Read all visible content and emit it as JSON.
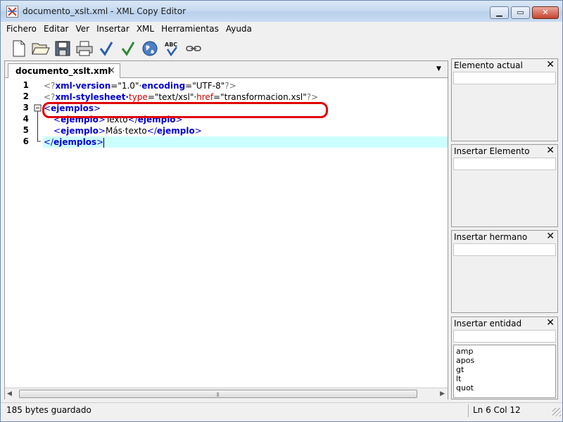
{
  "window": {
    "title": "documento_xslt.xml - XML Copy Editor"
  },
  "menu": [
    "Fichero",
    "Editar",
    "Ver",
    "Insertar",
    "XML",
    "Herramientas",
    "Ayuda"
  ],
  "toolbar": {
    "icons": [
      "new-document-icon",
      "open-folder-icon",
      "save-icon",
      "print-icon",
      "check-wellformed-icon",
      "validate-icon",
      "globe-icon",
      "spellcheck-icon",
      "link-icon"
    ]
  },
  "tab": {
    "label": "documento_xslt.xml",
    "close": "×"
  },
  "editor": {
    "line_numbers": [
      "1",
      "2",
      "3",
      "4",
      "5",
      "6"
    ],
    "lines": [
      {
        "p1": "<?",
        "p2": "xml·version",
        "p3": "=\"",
        "p4": "1.0",
        "p5": "\"·",
        "p6": "encoding",
        "p7": "=\"",
        "p8": "UTF-8",
        "p9": "\"",
        "p10": "?>"
      },
      {
        "p1": "<?",
        "p2": "xml-stylesheet·",
        "p3": "type",
        "p4": "=\"",
        "p5": "text/xsl",
        "p6": "\"·",
        "p7": "href",
        "p8": "=\"",
        "p9": "transformacion.xsl",
        "p10": "\"",
        "p11": "?>"
      },
      {
        "p1": "<",
        "p2": "ejemplos",
        "p3": ">"
      },
      {
        "p1": "<",
        "p2": "ejemplo",
        "p3": ">",
        "p4": "Texto",
        "p5": "</",
        "p6": "ejemplo",
        "p7": ">"
      },
      {
        "p1": "<",
        "p2": "ejemplo",
        "p3": ">",
        "p4": "Más·texto",
        "p5": "</",
        "p6": "ejemplo",
        "p7": ">"
      },
      {
        "p1": "</",
        "p2": "ejemplos",
        "p3": ">"
      }
    ],
    "current_line": 6
  },
  "panels": {
    "elemento_actual": {
      "title": "Elemento actual"
    },
    "insertar_elemento": {
      "title": "Insertar Elemento"
    },
    "insertar_hermano": {
      "title": "Insertar hermano"
    },
    "insertar_entidad": {
      "title": "Insertar entidad",
      "items": [
        "amp",
        "apos",
        "gt",
        "lt",
        "quot"
      ]
    }
  },
  "status": {
    "left": "185 bytes guardado",
    "right": "Ln 6 Col 12"
  },
  "colors": {
    "highlight": "#ccffff",
    "annotation": "#e00000",
    "tag": "#0000cc",
    "attribute": "#cc0000"
  }
}
